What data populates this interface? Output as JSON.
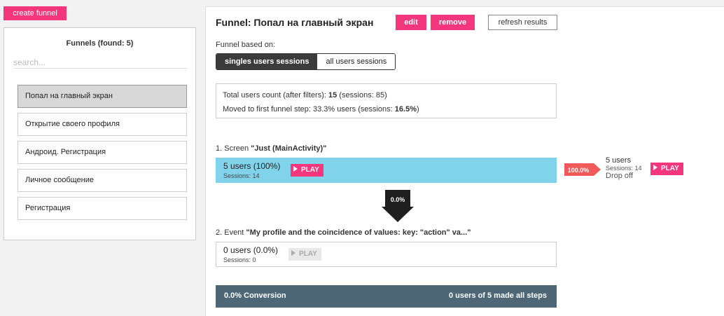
{
  "create_button": "create funnel",
  "sidebar": {
    "title": "Funnels (found: 5)",
    "search_placeholder": "search...",
    "items": [
      {
        "label": "Попал на главный экран"
      },
      {
        "label": "Открытие своего профиля"
      },
      {
        "label": "Андроид. Регистрация"
      },
      {
        "label": "Личное сообщение"
      },
      {
        "label": "Регистрация"
      }
    ]
  },
  "main": {
    "title": "Funnel: Попал на главный экран",
    "edit_label": "edit",
    "remove_label": "remove",
    "refresh_label": "refresh results",
    "based_on_label": "Funnel based on:",
    "toggle": {
      "singles": "singles users sessions",
      "all": "all users sessions"
    },
    "summary": {
      "line1_prefix": "Total users count (after filters): ",
      "line1_users": "15",
      "line1_sessions": " (sessions: 85)",
      "line2_prefix": "Moved to first funnel step: 33.3% users (sessions: ",
      "line2_sessions": "16.5%",
      "line2_suffix": ")"
    },
    "steps": [
      {
        "label_prefix": "1. Screen ",
        "label_name": "\"Just (MainActivity)\"",
        "users": "5 users",
        "percent": " (100%)",
        "sessions": "Sessions: 14",
        "play": "PLAY"
      },
      {
        "label_prefix": "2. Event ",
        "label_name": "\"My profile and the coincidence of values: key: \"action\" va...\"",
        "users": "0 users",
        "percent": " (0.0%)",
        "sessions": "Sessions: 0",
        "play": "PLAY"
      }
    ],
    "dropoff": {
      "percent": "100.0%",
      "users": "5 users",
      "sessions": "Sessions: 14",
      "label": "Drop off",
      "play": "PLAY"
    },
    "step_transition": "0.0%",
    "conversion": {
      "left": "0.0% Conversion",
      "right": "0 users of 5 made all steps"
    }
  },
  "colors": {
    "accent": "#f4367d",
    "step_fill": "#81d3ec",
    "dropoff": "#f05a5a",
    "conversion_bar": "#4d6776"
  }
}
